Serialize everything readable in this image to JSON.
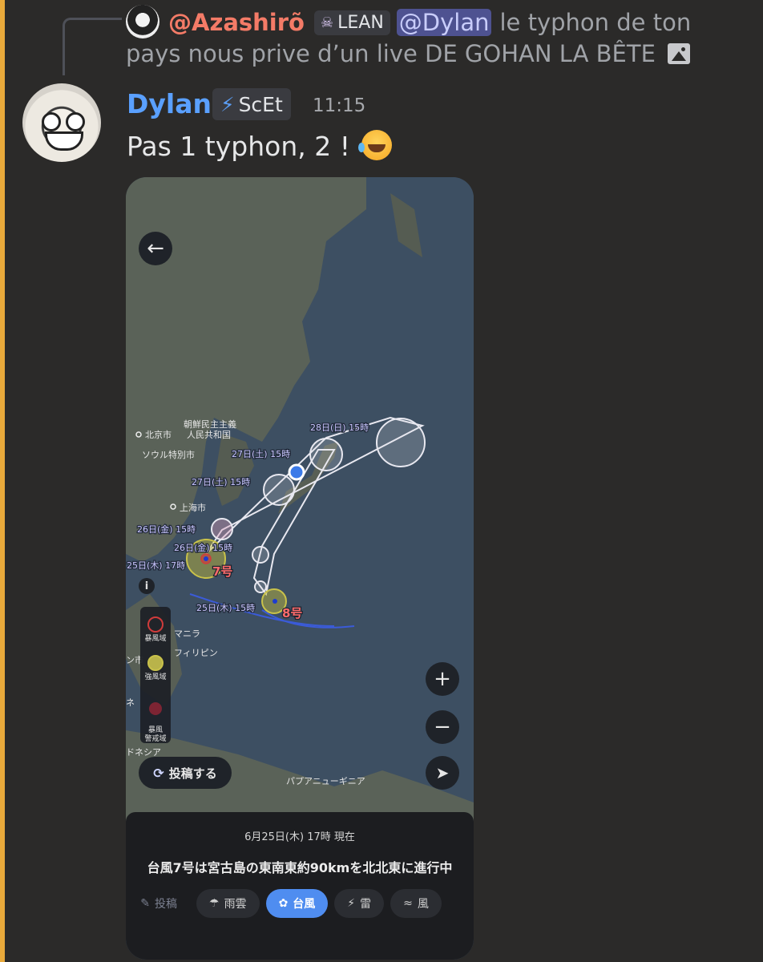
{
  "reply": {
    "author": "@Azashirõ",
    "role_icon": "skull-icon",
    "role_label": "LEAN",
    "mention": "@Dylan",
    "text_line1": "le typhon de ton",
    "text_line2": "pays nous prive d’un live DE GOHAN LA BÊTE"
  },
  "message": {
    "username": "Dylan",
    "badge_icon": "lightning-icon",
    "badge_label": "ScEt",
    "timestamp": "11:15",
    "text": "Pas 1 typhon, 2 !",
    "emoji": "rofl-emoji"
  },
  "app": {
    "map_labels": {
      "beijing": "北京市",
      "dprk": "朝鮮民主主義\n人民共和国",
      "seoul": "ソウル特別市",
      "shanghai": "上海市",
      "manila": "マニラ",
      "philippines": "フィリピン",
      "indonesia": "ドネシア",
      "png": "パプアニューギニア",
      "ne": "ネ",
      "cityfrag": "ン市"
    },
    "forecast_labels": [
      "28日(日) 15時",
      "27日(土) 15時",
      "27日(土) 15時",
      "26日(金) 15時",
      "26日(金) 15時",
      "25日(木) 17時",
      "25日(木) 15時"
    ],
    "typhoon_names": [
      "7号",
      "8号"
    ],
    "legend": [
      {
        "label": "暴風域",
        "color": "#d03b3b"
      },
      {
        "label": "強風域",
        "color": "#c9c24a"
      },
      {
        "label": "暴風\n警戒域",
        "color": "#b8334a"
      }
    ],
    "post_button": "投稿する",
    "sheet_date": "6月25日(木) 17時 現在",
    "sheet_status": "台風7号は宮古島の東南東約90kmを北北東に進行中",
    "tabs": [
      {
        "label": "投稿",
        "icon": "post-icon"
      },
      {
        "label": "雨雲",
        "icon": "rain-cloud-icon"
      },
      {
        "label": "台風",
        "icon": "typhoon-icon"
      },
      {
        "label": "雷",
        "icon": "lightning-icon"
      },
      {
        "label": "風",
        "icon": "wind-icon"
      }
    ],
    "colors": {
      "accent": "#4f8df0",
      "username": "#5aa0ff",
      "reply_author": "#f47b67",
      "typhoon_label": "#ff6b6b",
      "forecast_text": "#c9c6ff"
    }
  }
}
